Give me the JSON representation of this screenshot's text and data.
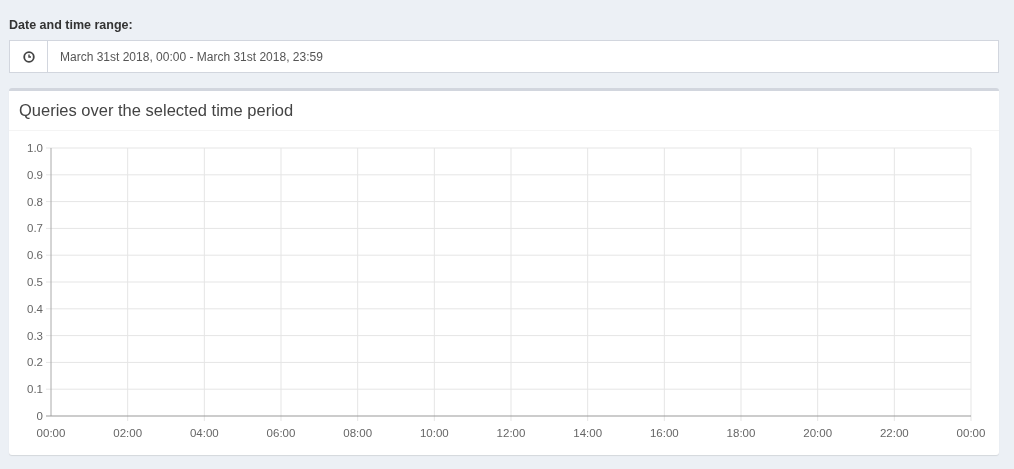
{
  "range_label": "Date and time range:",
  "range_field": {
    "value": "March 31st 2018, 00:00 - March 31st 2018, 23:59"
  },
  "chart_card": {
    "title": "Queries over the selected time period",
    "chart_data": {
      "type": "line",
      "grid": true,
      "x": [
        "00:00",
        "02:00",
        "04:00",
        "06:00",
        "08:00",
        "10:00",
        "12:00",
        "14:00",
        "16:00",
        "18:00",
        "20:00",
        "22:00",
        "00:00"
      ],
      "ylim": [
        0,
        1
      ],
      "yticks": [
        0,
        0.1,
        0.2,
        0.3,
        0.4,
        0.5,
        0.6,
        0.7,
        0.8,
        0.9,
        {
          "value": 1,
          "label": "1.0"
        }
      ]
    }
  }
}
